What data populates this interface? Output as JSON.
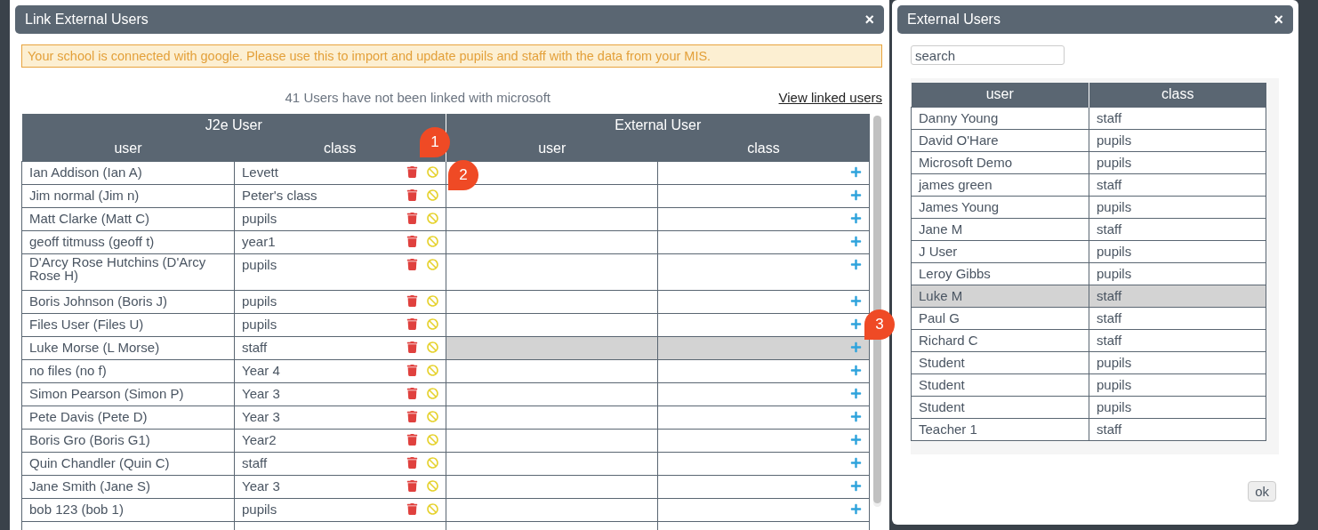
{
  "link_dialog": {
    "title": "Link External Users",
    "close": "×",
    "notice": "Your school is connected with google. Please use this to import and update pupils and staff with the data from your MIS.",
    "summary": "41 Users have not been linked with microsoft",
    "view_linked_link": "View linked users",
    "table": {
      "group_headers": [
        "J2e User",
        "External User"
      ],
      "columns": [
        "user",
        "class",
        "user",
        "class"
      ],
      "rows": [
        {
          "user": "Ian Addison (Ian A)",
          "class": "Levett",
          "selected": false
        },
        {
          "user": "Jim normal (Jim n)",
          "class": "Peter's class",
          "selected": false
        },
        {
          "user": "Matt Clarke (Matt C)",
          "class": "pupils",
          "selected": false
        },
        {
          "user": "geoff titmuss (geoff t)",
          "class": "year1",
          "selected": false
        },
        {
          "user": "D'Arcy Rose Hutchins (D'Arcy Rose H)",
          "class": "pupils",
          "selected": false
        },
        {
          "user": "Boris Johnson (Boris J)",
          "class": "pupils",
          "selected": false
        },
        {
          "user": "Files User (Files U)",
          "class": "pupils",
          "selected": false
        },
        {
          "user": "Luke Morse (L Morse)",
          "class": "staff",
          "selected": true
        },
        {
          "user": "no files (no f)",
          "class": "Year 4",
          "selected": false
        },
        {
          "user": "Simon Pearson (Simon P)",
          "class": "Year 3",
          "selected": false
        },
        {
          "user": "Pete Davis (Pete D)",
          "class": "Year 3",
          "selected": false
        },
        {
          "user": "Boris Gro (Boris G1)",
          "class": "Year2",
          "selected": false
        },
        {
          "user": "Quin Chandler (Quin C)",
          "class": "staff",
          "selected": false
        },
        {
          "user": "Jane Smith (Jane S)",
          "class": "Year 3",
          "selected": false
        },
        {
          "user": "bob 123 (bob 1)",
          "class": "pupils",
          "selected": false
        }
      ]
    }
  },
  "annotations": [
    {
      "label": "1"
    },
    {
      "label": "2"
    },
    {
      "label": "3"
    }
  ],
  "external_dialog": {
    "title": "External Users",
    "close": "×",
    "search": {
      "placeholder": "search"
    },
    "table": {
      "columns": [
        "user",
        "class"
      ],
      "rows": [
        {
          "user": "Danny Young",
          "class": "staff",
          "selected": false
        },
        {
          "user": "David O'Hare",
          "class": "pupils",
          "selected": false
        },
        {
          "user": "Microsoft Demo",
          "class": "pupils",
          "selected": false
        },
        {
          "user": "james green",
          "class": "staff",
          "selected": false
        },
        {
          "user": "James Young",
          "class": "pupils",
          "selected": false
        },
        {
          "user": "Jane M",
          "class": "staff",
          "selected": false
        },
        {
          "user": "J User",
          "class": "pupils",
          "selected": false
        },
        {
          "user": "Leroy Gibbs",
          "class": "pupils",
          "selected": false
        },
        {
          "user": "Luke M",
          "class": "staff",
          "selected": true
        },
        {
          "user": "Paul G",
          "class": "staff",
          "selected": false
        },
        {
          "user": "Richard C",
          "class": "staff",
          "selected": false
        },
        {
          "user": "Student",
          "class": "pupils",
          "selected": false
        },
        {
          "user": "Student",
          "class": "pupils",
          "selected": false
        },
        {
          "user": "Student",
          "class": "pupils",
          "selected": false
        },
        {
          "user": "Teacher 1",
          "class": "staff",
          "selected": false
        }
      ]
    },
    "ok_button": "ok"
  }
}
